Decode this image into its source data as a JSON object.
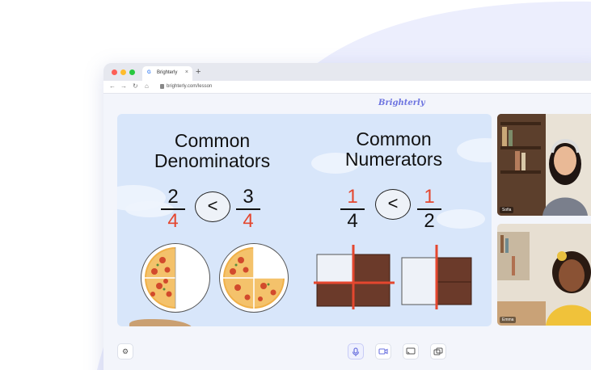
{
  "browser": {
    "tab_title": "Brighterly",
    "tab_favicon": "G",
    "tab_close": "×",
    "new_tab": "+",
    "url": "brighterly.com/lesson"
  },
  "app": {
    "logo": "Brighterly"
  },
  "lesson": {
    "left": {
      "title_line1": "Common",
      "title_line2": "Denominators",
      "fraction_a": {
        "numerator": "2",
        "denominator": "4"
      },
      "comparison": "<",
      "fraction_b": {
        "numerator": "3",
        "denominator": "4"
      }
    },
    "right": {
      "title_line1": "Common",
      "title_line2": "Numerators",
      "fraction_a": {
        "numerator": "1",
        "denominator": "4"
      },
      "comparison": "<",
      "fraction_b": {
        "numerator": "1",
        "denominator": "2"
      }
    }
  },
  "participants": [
    {
      "name": "Sofia"
    },
    {
      "name": "Emma"
    }
  ],
  "controls": {
    "settings_icon": "gear-icon",
    "mic_icon": "microphone-icon",
    "camera_icon": "camera-icon",
    "cast_icon": "screen-share-icon",
    "layout_icon": "pip-icon"
  },
  "colors": {
    "accent": "#6d74e0",
    "fraction_red": "#e4472f",
    "stage_bg": "#d8e6fa"
  }
}
